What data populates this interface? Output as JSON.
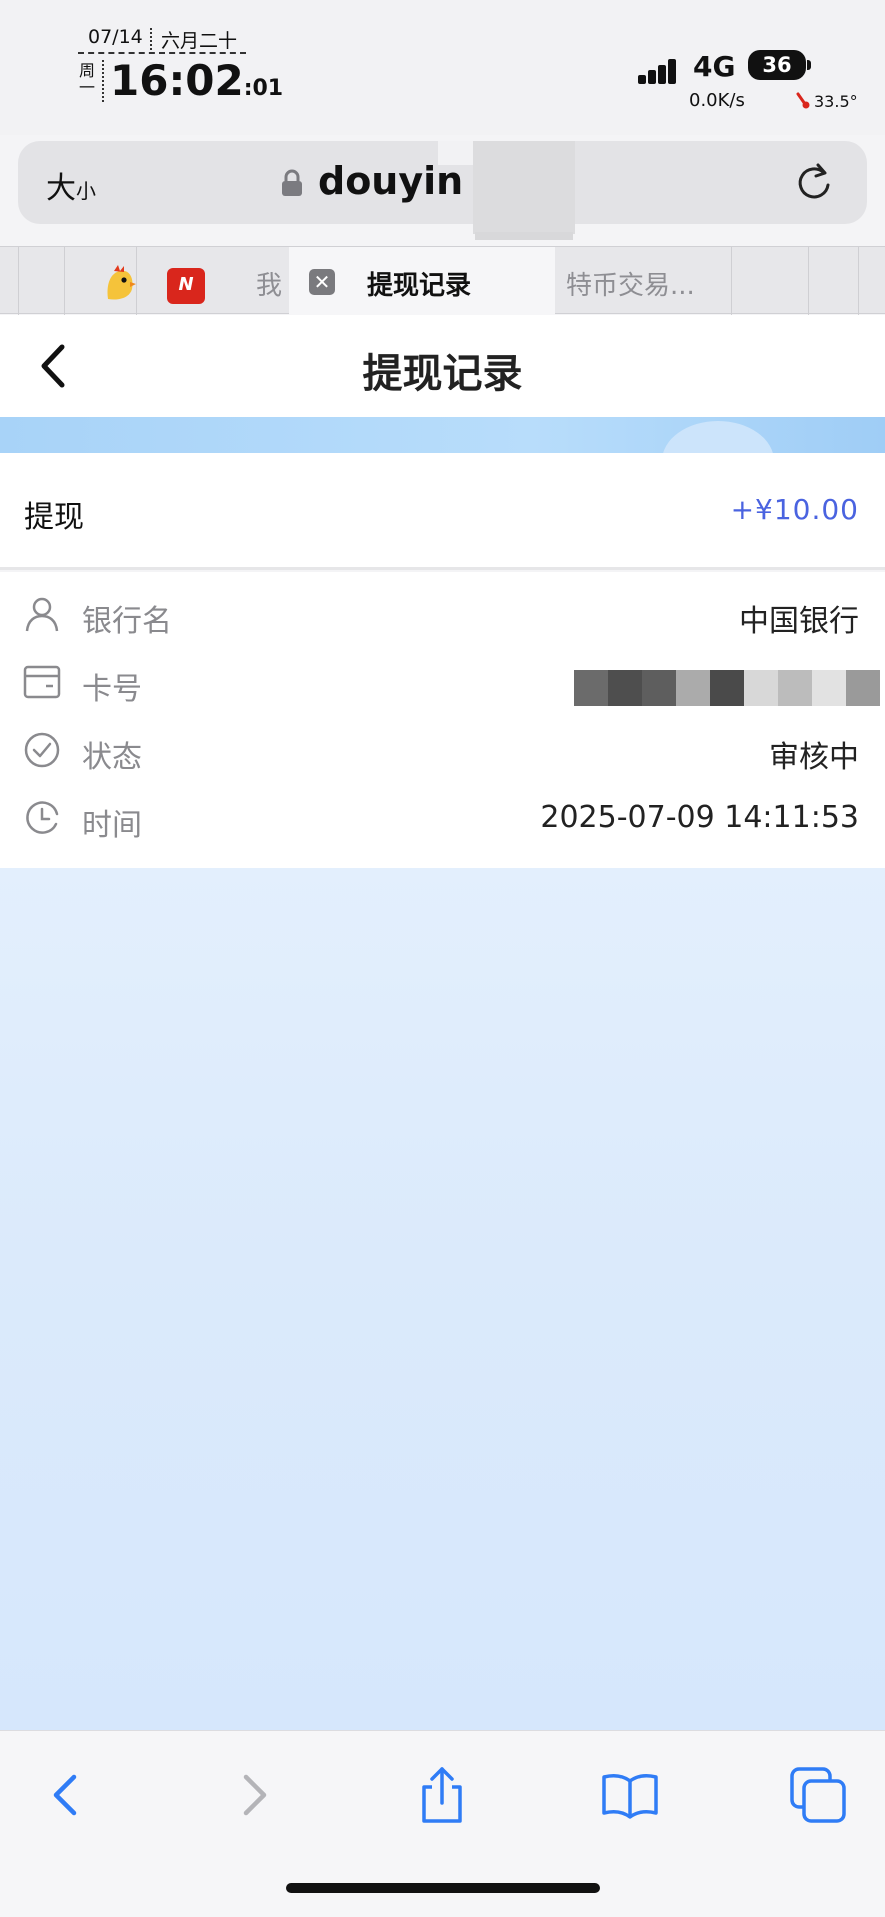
{
  "status_bar": {
    "date": "07/14",
    "lunar_date": "六月二十",
    "weekday": "周一",
    "time": "16:02",
    "seconds": ":01",
    "network": "4G",
    "battery": "36",
    "speed": "0.0K/s",
    "temperature": "33.5°"
  },
  "address_bar": {
    "text_size_big": "大",
    "text_size_small": "小",
    "url": "douyin"
  },
  "tabs": {
    "left_fragment": "我",
    "app_badge": "N",
    "active_label": "提现记录",
    "right_fragment": "特币交易..."
  },
  "page": {
    "title": "提现记录"
  },
  "record": {
    "type_label": "提现",
    "amount": "+¥10.00",
    "rows": [
      {
        "icon": "user-icon",
        "label": "银行名",
        "value": "中国银行"
      },
      {
        "icon": "card-icon",
        "label": "卡号",
        "value": ""
      },
      {
        "icon": "check-circle-icon",
        "label": "状态",
        "value": "审核中"
      },
      {
        "icon": "clock-icon",
        "label": "时间",
        "value": "2025-07-09 14:11:53"
      }
    ]
  },
  "colors": {
    "amount": "#4a63e0",
    "accent_blue": "#2f7cf6",
    "banner": "#a8d3f8",
    "page_bg": "#dbeafb"
  }
}
